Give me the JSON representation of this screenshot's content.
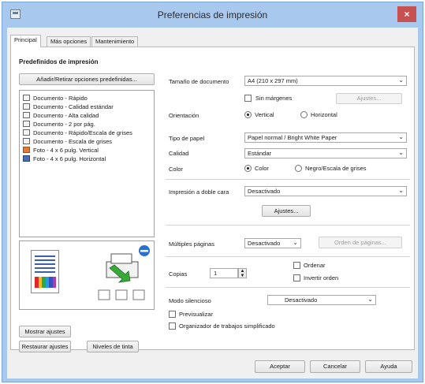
{
  "window": {
    "title": "Preferencias de impresión",
    "close": "×"
  },
  "tabs": [
    {
      "label": "Principal"
    },
    {
      "label": "Más opciones"
    },
    {
      "label": "Mantenimiento"
    }
  ],
  "presets": {
    "title": "Predefinidos de impresión",
    "add_button": "Añadir/Retirar opciones predefinidas...",
    "items": [
      {
        "label": "Documento - Rápido",
        "icon": "document-icon"
      },
      {
        "label": "Documento - Calidad estándar",
        "icon": "document-icon"
      },
      {
        "label": "Documento - Alta calidad",
        "icon": "document-icon"
      },
      {
        "label": "Documento - 2 por pág.",
        "icon": "document-icon"
      },
      {
        "label": "Documento - Rápido/Escala de grises",
        "icon": "document-icon"
      },
      {
        "label": "Documento - Escala de grises",
        "icon": "document-icon"
      },
      {
        "label": "Foto - 4 x 6 pulg. Vertical",
        "icon": "photo-icon"
      },
      {
        "label": "Foto - 4 x 6 pulg. Horizontal",
        "icon": "photo-icon"
      }
    ],
    "show_settings": "Mostrar ajustes",
    "reset_settings": "Restaurar ajustes",
    "ink_levels": "Niveles de tinta"
  },
  "settings": {
    "doc_size_label": "Tamaño de documento",
    "doc_size_value": "A4 (210 x 297 mm)",
    "borderless": "Sin márgenes",
    "borderless_settings": "Ajustes...",
    "orientation_label": "Orientación",
    "orientation_vertical": "Vertical",
    "orientation_horizontal": "Horizontal",
    "paper_type_label": "Tipo de papel",
    "paper_type_value": "Papel normal / Bright White Paper",
    "quality_label": "Calidad",
    "quality_value": "Estándar",
    "color_label": "Color",
    "color_color": "Color",
    "color_gray": "Negro/Escala de grises",
    "duplex_label": "Impresión a doble cara",
    "duplex_value": "Desactivado",
    "duplex_settings": "Ajustes...",
    "multipage_label": "Múltiples páginas",
    "multipage_value": "Desactivado",
    "page_order": "Orden de páginas...",
    "copies_label": "Copias",
    "copies_value": "1",
    "collate": "Ordenar",
    "reverse": "Invertir orden",
    "quiet_label": "Modo silencioso",
    "quiet_value": "Desactivado",
    "preview": "Previsualizar",
    "organizer": "Organizador de trabajos simplificado"
  },
  "footer": {
    "ok": "Aceptar",
    "cancel": "Cancelar",
    "help": "Ayuda"
  }
}
